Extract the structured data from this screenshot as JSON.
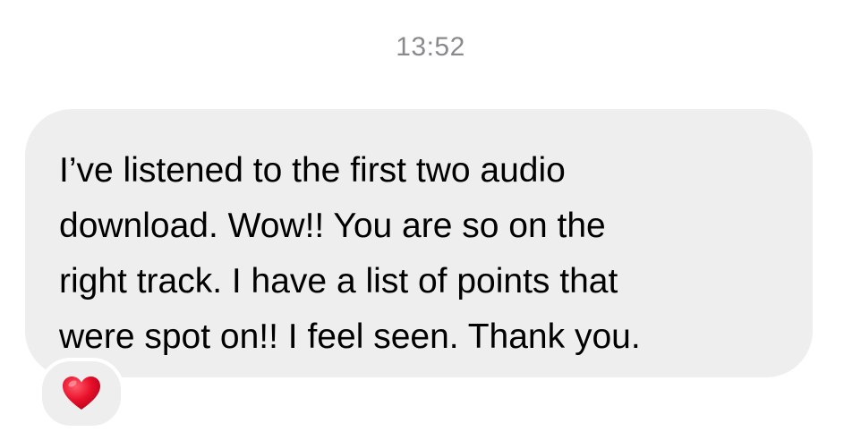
{
  "timestamp": "13:52",
  "message": {
    "text": "I’ve listened to the first two audio\ndownload.  Wow!! You are so on the\nright track. I have a list of points that\nwere spot on!! I feel seen. Thank you.",
    "bubble_color": "#eeeeee",
    "text_color": "#000000"
  },
  "reaction": {
    "icon": "red-heart-icon",
    "color": "#e8102a"
  }
}
